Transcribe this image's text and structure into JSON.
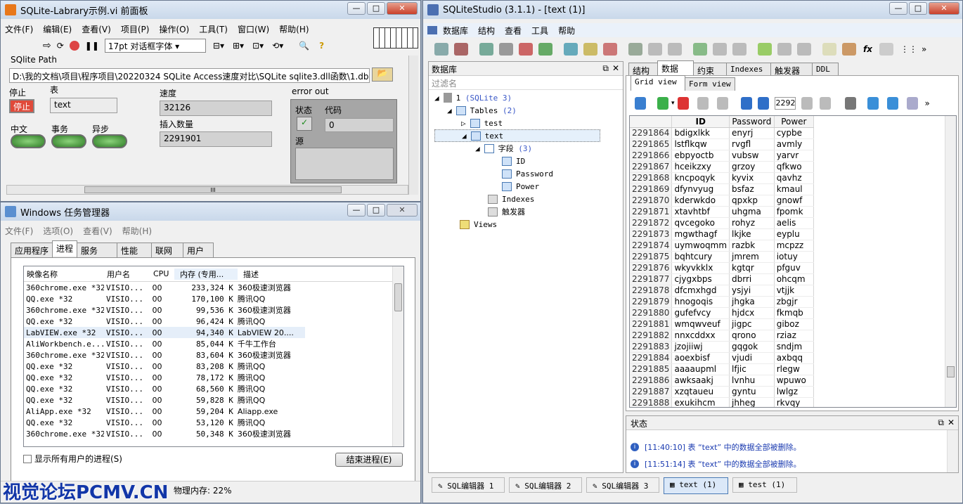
{
  "labview": {
    "title": "SQLite-Labrary示例.vi 前面板",
    "menu": [
      "文件(F)",
      "编辑(E)",
      "查看(V)",
      "项目(P)",
      "操作(O)",
      "工具(T)",
      "窗口(W)",
      "帮助(H)"
    ],
    "font": "17pt 对话框字体",
    "path_label": "SQlite Path",
    "path_value": "D:\\我的文档\\项目\\程序项目\\20220324 SQLite Access速度对比\\SQLite sqlite3.dll函数\\1.db",
    "stop_label": "停止",
    "stop_btn": "停止",
    "table_label": "表",
    "table_value": "text",
    "speed_label": "速度",
    "speed_value": "32126",
    "insert_label": "插入数量",
    "insert_value": "2291901",
    "error_label": "error out",
    "status_label": "状态",
    "code_label": "代码",
    "code_value": "0",
    "source_label": "源",
    "cn_label": "中文",
    "tx_label": "事务",
    "async_label": "异步",
    "hscroll": "III"
  },
  "taskmgr": {
    "title": "Windows 任务管理器",
    "menu": [
      "文件(F)",
      "选项(O)",
      "查看(V)",
      "帮助(H)"
    ],
    "tabs": [
      "应用程序",
      "进程",
      "服务",
      "性能",
      "联网",
      "用户"
    ],
    "cols": [
      "映像名称",
      "用户名",
      "CPU",
      "内存 (专用...",
      "描述"
    ],
    "rows": [
      [
        "360chrome.exe *32",
        "VISIO...",
        "00",
        "233,324 K",
        "360极速浏览器"
      ],
      [
        "QQ.exe *32",
        "VISIO...",
        "00",
        "170,100 K",
        "腾讯QQ"
      ],
      [
        "360chrome.exe *32",
        "VISIO...",
        "00",
        "99,536 K",
        "360极速浏览器"
      ],
      [
        "QQ.exe *32",
        "VISIO...",
        "00",
        "96,424 K",
        "腾讯QQ"
      ],
      [
        "LabVIEW.exe *32",
        "VISIO...",
        "00",
        "94,340 K",
        "LabVIEW 20...."
      ],
      [
        "AliWorkbench.e...",
        "VISIO...",
        "00",
        "85,044 K",
        "千牛工作台"
      ],
      [
        "360chrome.exe *32",
        "VISIO...",
        "00",
        "83,604 K",
        "360极速浏览器"
      ],
      [
        "QQ.exe *32",
        "VISIO...",
        "00",
        "83,208 K",
        "腾讯QQ"
      ],
      [
        "QQ.exe *32",
        "VISIO...",
        "00",
        "78,172 K",
        "腾讯QQ"
      ],
      [
        "QQ.exe *32",
        "VISIO...",
        "00",
        "68,560 K",
        "腾讯QQ"
      ],
      [
        "QQ.exe *32",
        "VISIO...",
        "00",
        "59,828 K",
        "腾讯QQ"
      ],
      [
        "AliApp.exe *32",
        "VISIO...",
        "00",
        "59,204 K",
        "Aliapp.exe"
      ],
      [
        "QQ.exe *32",
        "VISIO...",
        "00",
        "53,120 K",
        "腾讯QQ"
      ],
      [
        "360chrome.exe *32",
        "VISIO...",
        "00",
        "50,348 K",
        "360极速浏览器"
      ]
    ],
    "show_all": "显示所有用户的进程(S)",
    "end_btn": "结束进程(E)",
    "memory": "物理内存: 22%"
  },
  "studio": {
    "title": "SQLiteStudio (3.1.1) - [text (1)]",
    "menu": [
      "数据库",
      "结构",
      "查看",
      "工具",
      "帮助"
    ],
    "db_title": "数据库",
    "filter": "过滤名",
    "tree": {
      "db": "1",
      "db_ver": "(SQLite 3)",
      "tables": "Tables",
      "tables_count": "(2)",
      "t1": "test",
      "t2": "text",
      "cols_label": "字段",
      "cols_count": "(3)",
      "c1": "ID",
      "c2": "Password",
      "c3": "Power",
      "indexes": "Indexes",
      "triggers": "触发器",
      "views": "Views"
    },
    "tabs": [
      "结构",
      "数据",
      "约束",
      "Indexes",
      "触发器",
      "DDL"
    ],
    "subtabs": [
      "Grid view",
      "Form view"
    ],
    "page": "2292",
    "grid_cols": [
      "ID",
      "Password",
      "Power"
    ],
    "grid": [
      [
        "2291864",
        "bdigxlkk",
        "enyrj",
        "cypbe"
      ],
      [
        "2291865",
        "lstflkqw",
        "rvgfl",
        "avmly"
      ],
      [
        "2291866",
        "ebpyoctb",
        "vubsw",
        "yarvr"
      ],
      [
        "2291867",
        "hceikzxy",
        "grzoy",
        "qfkwo"
      ],
      [
        "2291868",
        "kncpoqyk",
        "kyvix",
        "qavhz"
      ],
      [
        "2291869",
        "dfynvyug",
        "bsfaz",
        "kmaul"
      ],
      [
        "2291870",
        "kderwkdo",
        "qpxkp",
        "gnowf"
      ],
      [
        "2291871",
        "xtavhtbf",
        "uhgma",
        "fpomk"
      ],
      [
        "2291872",
        "qvcegoko",
        "rohyz",
        "aelis"
      ],
      [
        "2291873",
        "mgwthagf",
        "lkjke",
        "eyplu"
      ],
      [
        "2291874",
        "uymwoqmm",
        "razbk",
        "mcpzz"
      ],
      [
        "2291875",
        "bqhtcury",
        "jmrem",
        "iotuy"
      ],
      [
        "2291876",
        "wkyvkklx",
        "kgtqr",
        "pfguv"
      ],
      [
        "2291877",
        "cjygxbps",
        "dbrri",
        "ohcqm"
      ],
      [
        "2291878",
        "dfcmxhgd",
        "ysjyi",
        "vtjjk"
      ],
      [
        "2291879",
        "hnogoqis",
        "jhgka",
        "zbgjr"
      ],
      [
        "2291880",
        "gufefvcy",
        "hjdcx",
        "fkmqb"
      ],
      [
        "2291881",
        "wmqwveuf",
        "jigpc",
        "giboz"
      ],
      [
        "2291882",
        "nnxcddxx",
        "qrono",
        "rziaz"
      ],
      [
        "2291883",
        "jzojiiwj",
        "gqgok",
        "sndjm"
      ],
      [
        "2291884",
        "aoexbisf",
        "vjudi",
        "axbqq"
      ],
      [
        "2291885",
        "aaaaupml",
        "lfjic",
        "rlegw"
      ],
      [
        "2291886",
        "awksaakj",
        "lvnhu",
        "wpuwo"
      ],
      [
        "2291887",
        "xzqtaueu",
        "gyntu",
        "lwlgz"
      ],
      [
        "2291888",
        "exukihcm",
        "jhheg",
        "rkvqy"
      ]
    ],
    "status_title": "状态",
    "logs": [
      "[11:40:10] 表 “text” 中的数据全部被删除。",
      "[11:51:14] 表 “text” 中的数据全部被删除。"
    ],
    "bottom_tabs": [
      "SQL编辑器 1",
      "SQL编辑器 2",
      "SQL编辑器 3",
      "text (1)",
      "test (1)"
    ]
  },
  "watermark": "视觉论坛PCMV.CN"
}
